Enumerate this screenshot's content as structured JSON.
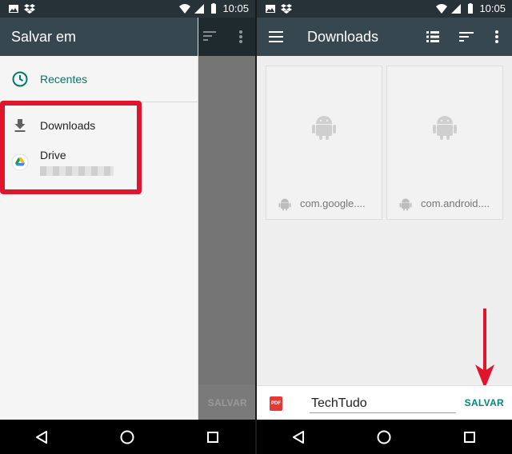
{
  "status_bar": {
    "time": "10:05"
  },
  "left": {
    "drawer_title": "Salvar em",
    "items": [
      {
        "label": "Recentes",
        "icon": "clock-icon"
      },
      {
        "label": "Downloads",
        "icon": "download-icon"
      },
      {
        "label": "Drive",
        "icon": "google-drive-icon"
      }
    ],
    "scrim_save_label": "SALVAR"
  },
  "right": {
    "title": "Downloads",
    "cards": [
      {
        "name": "com.google...."
      },
      {
        "name": "com.android...."
      }
    ],
    "file_type_badge": "PDF",
    "file_name": "TechTudo",
    "save_label": "SALVAR"
  },
  "colors": {
    "app_bar": "#37474f",
    "status_bar": "#263238",
    "accent_teal": "#00796b",
    "highlight_red": "#e0142a"
  }
}
